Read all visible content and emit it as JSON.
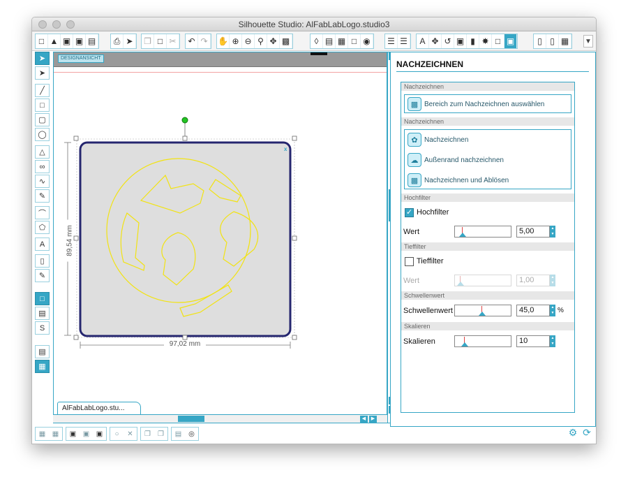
{
  "window": {
    "title": "Silhouette Studio: AlFabLabLogo.studio3"
  },
  "toolbar": {
    "groups": [
      [
        "D",
        "O",
        "S",
        "S",
        "S"
      ],
      [
        "P",
        "P"
      ],
      [
        "C",
        "V",
        "X"
      ],
      [
        "U",
        "R"
      ],
      [
        "H",
        "+",
        "-",
        "Z",
        "Z",
        "F"
      ],
      [
        "A",
        "W",
        "G",
        "K",
        "Q"
      ],
      [
        "L",
        "L"
      ],
      [
        "T",
        "M",
        "R",
        "R",
        "R",
        "W",
        "W",
        "W"
      ],
      [
        "P",
        "C",
        "G"
      ]
    ]
  },
  "canvas": {
    "tag": "DESIGNANSICHT",
    "width_label": "97,02 mm",
    "height_label": "89,54 mm",
    "doc_tab": "AlFabLabLogo.stu..."
  },
  "panel": {
    "title": "NACHZEICHNEN",
    "section_select": {
      "header": "Nachzeichnen",
      "button": "Bereich zum Nachzeichnen auswählen"
    },
    "section_trace": {
      "header": "Nachzeichnen",
      "items": [
        "Nachzeichnen",
        "Außenrand nachzeichnen",
        "Nachzeichnen und Ablösen"
      ]
    },
    "highpass": {
      "header": "Hochfilter",
      "checkbox_label": "Hochfilter",
      "checked": true,
      "value_label": "Wert",
      "value": "5,00",
      "level": 0.05
    },
    "lowpass": {
      "header": "Tieffilter",
      "checkbox_label": "Tieffilter",
      "checked": false,
      "value_label": "Wert",
      "value": "1,00",
      "level": 0.01
    },
    "threshold": {
      "header": "Schwellenwert",
      "label": "Schwellenwert",
      "value": "45,0",
      "unit": "%",
      "level": 0.45
    },
    "scale": {
      "header": "Skalieren",
      "label": "Skalieren",
      "value": "10",
      "level": 0.1
    }
  }
}
